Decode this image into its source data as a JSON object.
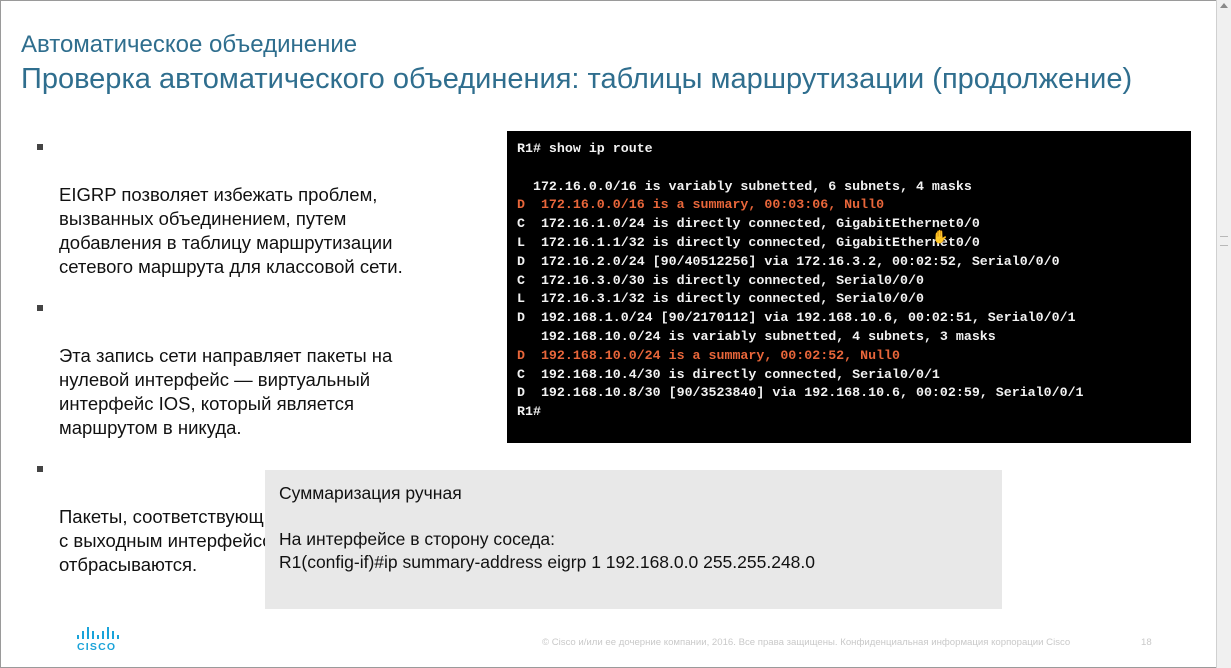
{
  "slide": {
    "subtitle": "Автоматическое объединение",
    "title": "Проверка автоматического объединения: таблицы маршрутизации (продолжение)",
    "bullets": [
      "EIGRP позволяет избежать проблем,\nвызванных объединением, путем\nдобавления в таблицу маршрутизации\nсетевого маршрута для классовой сети.",
      "Эта запись сети направляет пакеты на\nнулевой интерфейс — виртуальный\nинтерфейс IOS, который является\nмаршрутом в никуда.",
      "Пакеты, соответствующие маршруту\nс выходным интерфейсом Null0,\nотбрасываются."
    ],
    "terminal": {
      "lines": [
        {
          "text": "R1# show ip route",
          "highlight": false
        },
        {
          "text": "",
          "highlight": false
        },
        {
          "text": "  172.16.0.0/16 is variably subnetted, 6 subnets, 4 masks",
          "highlight": false
        },
        {
          "text": "D  172.16.0.0/16 is a summary, 00:03:06, Null0",
          "highlight": true
        },
        {
          "text": "C  172.16.1.0/24 is directly connected, GigabitEthernet0/0",
          "highlight": false
        },
        {
          "text": "L  172.16.1.1/32 is directly connected, GigabitEthernet0/0",
          "highlight": false
        },
        {
          "text": "D  172.16.2.0/24 [90/40512256] via 172.16.3.2, 00:02:52, Serial0/0/0",
          "highlight": false
        },
        {
          "text": "C  172.16.3.0/30 is directly connected, Serial0/0/0",
          "highlight": false
        },
        {
          "text": "L  172.16.3.1/32 is directly connected, Serial0/0/0",
          "highlight": false
        },
        {
          "text": "D  192.168.1.0/24 [90/2170112] via 192.168.10.6, 00:02:51, Serial0/0/1",
          "highlight": false
        },
        {
          "text": "   192.168.10.0/24 is variably subnetted, 4 subnets, 3 masks",
          "highlight": false
        },
        {
          "text": "D  192.168.10.0/24 is a summary, 00:02:52, Null0",
          "highlight": true
        },
        {
          "text": "C  192.168.10.4/30 is directly connected, Serial0/0/1",
          "highlight": false
        },
        {
          "text": "D  192.168.10.8/30 [90/3523840] via 192.168.10.6, 00:02:59, Serial0/0/1",
          "highlight": false
        },
        {
          "text": "R1#",
          "highlight": false
        }
      ]
    },
    "note": {
      "lines": [
        "Суммаризация ручная",
        "",
        "На интерфейсе в сторону соседа:",
        "R1(config-if)#ip summary-address eigrp 1 192.168.0.0 255.255.248.0"
      ]
    },
    "logo_text": "CISCO",
    "footer": "© Cisco и/или ее дочерние компании, 2016. Все права защищены. Конфиденциальная информация корпорации Cisco",
    "page_number": "18",
    "colors": {
      "title": "#2f6e8e",
      "terminal_bg": "#000000",
      "terminal_text": "#f2f2f2",
      "terminal_highlight": "#e8663a",
      "note_bg": "#e8e8e8",
      "logo": "#1aa3d9"
    },
    "icons": [
      "hand-cursor-icon",
      "cisco-logo-icon"
    ]
  }
}
